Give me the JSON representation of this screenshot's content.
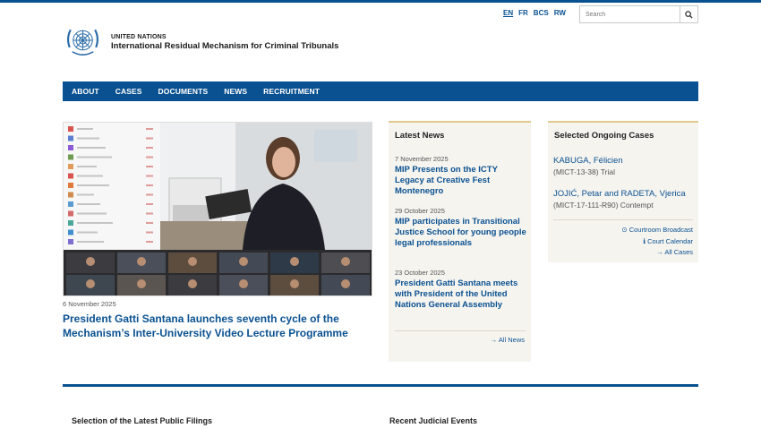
{
  "header": {
    "languages": [
      "EN",
      "FR",
      "BCS",
      "RW"
    ],
    "search_placeholder": "Search",
    "org_small": "UNITED NATIONS",
    "org_name": "International Residual Mechanism for Criminal Tribunals"
  },
  "nav": [
    "ABOUT",
    "CASES",
    "DOCUMENTS",
    "NEWS",
    "RECRUITMENT"
  ],
  "feature": {
    "date": "6 November 2025",
    "title": "President Gatti Santana launches seventh cycle of the Mechanism’s Inter-University Video Lecture Programme"
  },
  "latest_news": {
    "heading": "Latest News",
    "items": [
      {
        "date": "7 November 2025",
        "title": "MIP Presents on the ICTY Legacy at Creative Fest Montenegro"
      },
      {
        "date": "29 October 2025",
        "title": "MIP participates in Transitional Justice School for young people legal professionals"
      },
      {
        "date": "23 October 2025",
        "title": "President Gatti Santana meets with President of the United Nations General Assembly"
      }
    ],
    "all_link": "All News"
  },
  "cases": {
    "heading": "Selected Ongoing Cases",
    "items": [
      {
        "name": "KABUGA, Félicien",
        "code": "(MICT-13-38) Trial"
      },
      {
        "name": "JOJIĆ, Petar and RADETA, Vjerica",
        "code": "(MICT-17-111-R90) Contempt"
      }
    ],
    "links": [
      "Courtroom Broadcast",
      "Court Calendar",
      "All Cases"
    ]
  },
  "sections": {
    "filings": "Selection of the Latest Public Filings",
    "events": "Recent Judicial Events"
  },
  "colors": {
    "brand": "#0a5191",
    "accent": "#e4c98f",
    "panel": "#f6f4ef"
  }
}
